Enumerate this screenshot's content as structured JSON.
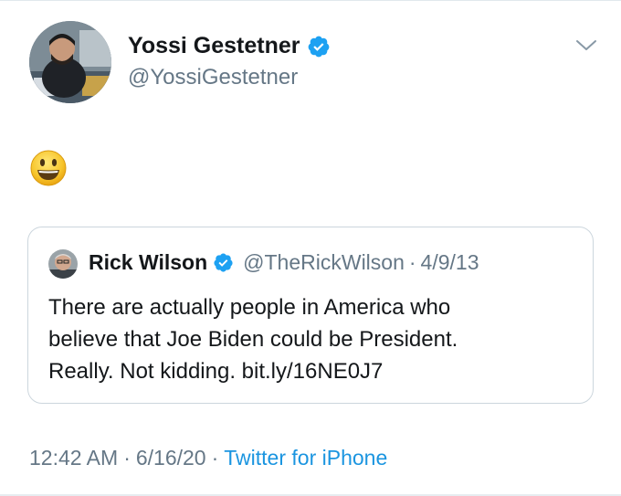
{
  "tweet": {
    "author": {
      "name": "Yossi Gestetner",
      "handle": "@YossiGestetner",
      "verified": true
    },
    "body": {
      "emoji": "smiling-face-with-open-mouth"
    },
    "quote": {
      "author_name": "Rick Wilson",
      "handle": "@TheRickWilson",
      "separator": "·",
      "date": "4/9/13",
      "verified": true,
      "text_lines": [
        "There are actually people in America who",
        "believe that Joe Biden could be President.",
        "Really. Not kidding. bit.ly/16NE0J7"
      ]
    },
    "meta": {
      "time": "12:42 AM",
      "separator": "·",
      "date": "6/16/20",
      "source": "Twitter for iPhone"
    }
  },
  "icons": {
    "verified": "verified-badge-icon",
    "menu": "chevron-down-icon"
  },
  "colors": {
    "verified_blue": "#1da1f2",
    "link_blue": "#1b95e0",
    "secondary_text": "#657786",
    "primary_text": "#14171a",
    "card_border": "#ccd6dd"
  }
}
